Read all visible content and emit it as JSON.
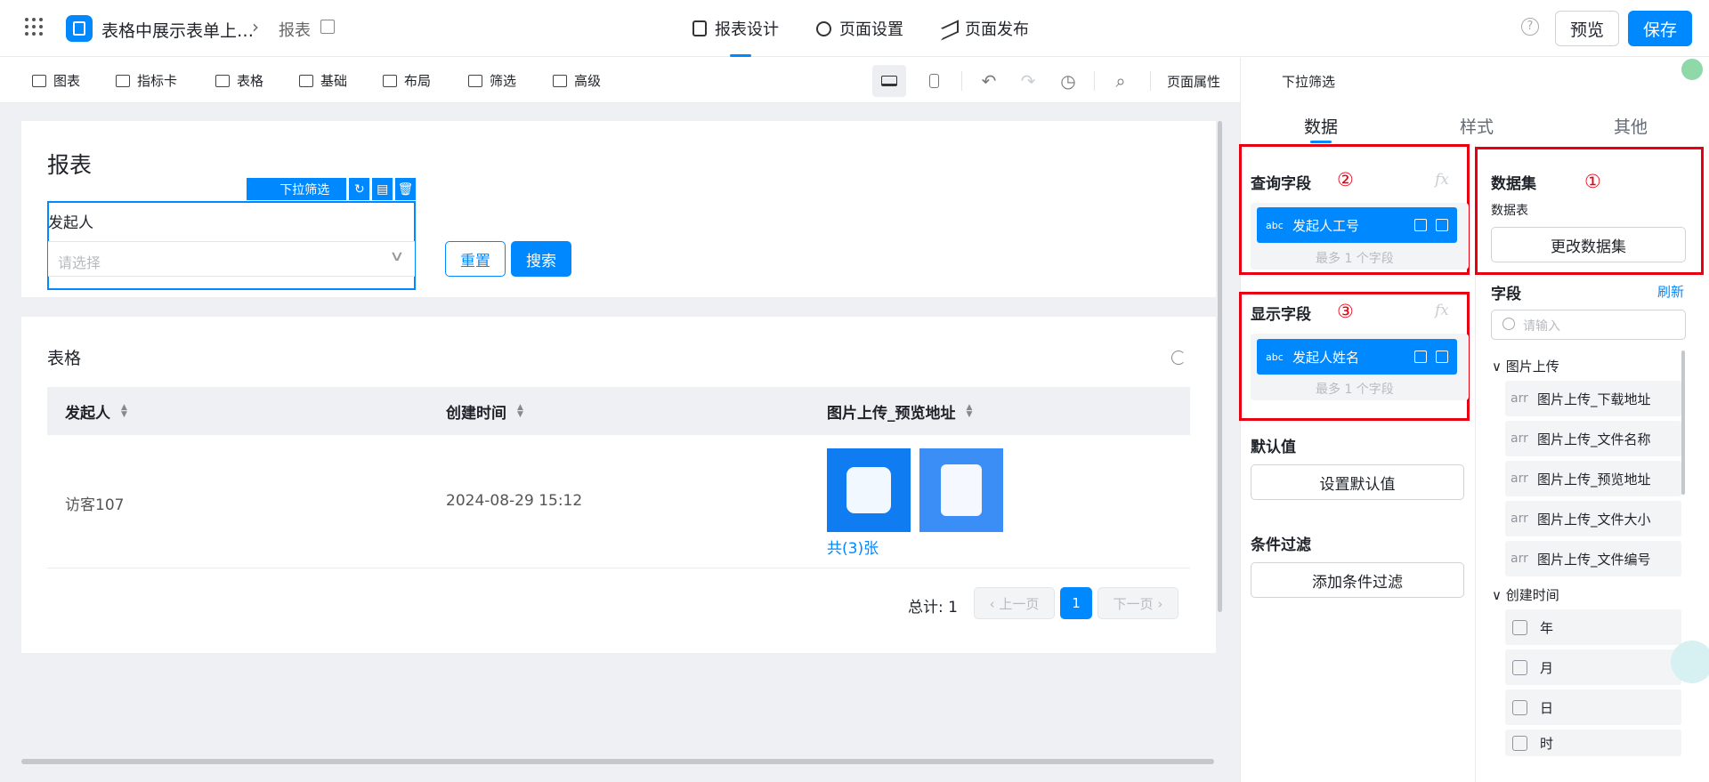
{
  "topbar": {
    "app_title": "表格中展示表单上…",
    "breadcrumb_sep": "›",
    "page_name": "报表",
    "tabs": [
      {
        "label": "报表设计",
        "icon": "report-icon",
        "active": true
      },
      {
        "label": "页面设置",
        "icon": "gear-icon",
        "active": false
      },
      {
        "label": "页面发布",
        "icon": "send-icon",
        "active": false
      }
    ],
    "help": "?",
    "preview_label": "预览",
    "save_label": "保存",
    "accent_color": "#0089ff"
  },
  "toolbar": {
    "items": [
      {
        "label": "图表",
        "icon": "bar-chart-icon"
      },
      {
        "label": "指标卡",
        "icon": "metric-icon"
      },
      {
        "label": "表格",
        "icon": "table-icon"
      },
      {
        "label": "基础",
        "icon": "grid-icon"
      },
      {
        "label": "布局",
        "icon": "layout-icon"
      },
      {
        "label": "筛选",
        "icon": "filter-icon"
      },
      {
        "label": "高级",
        "icon": "layers-icon"
      }
    ],
    "undo": "↶",
    "redo": "↷",
    "history": "◷",
    "search": "⌕",
    "page_props": "页面属性"
  },
  "canvas": {
    "report_title": "报表",
    "component_label": "下拉筛选",
    "component_actions": [
      "↻",
      "▤",
      "🗑"
    ],
    "filter": {
      "label": "发起人",
      "placeholder": "请选择",
      "chevron": "∨",
      "reset_label": "重置",
      "search_label": "搜索"
    },
    "table": {
      "title": "表格",
      "columns": [
        "发起人",
        "创建时间",
        "图片上传_预览地址"
      ],
      "rows": [
        {
          "initiator": "访客107",
          "created": "2024-08-29 15:12",
          "images_link": "共(3)张"
        }
      ],
      "total": "总计: 1",
      "prev": "‹ 上一页",
      "page": "1",
      "next": "下一页 ›"
    }
  },
  "panel": {
    "title": "下拉筛选",
    "tabs": [
      "数据",
      "样式",
      "其他"
    ],
    "query_field": {
      "title": "查询字段",
      "marker": "②",
      "chip_type": "abc",
      "chip_name": "发起人工号",
      "hint": "最多 1 个字段",
      "fx": "fx"
    },
    "display_field": {
      "title": "显示字段",
      "marker": "③",
      "chip_type": "abc",
      "chip_name": "发起人姓名",
      "hint": "最多 1 个字段",
      "fx": "fx"
    },
    "default_value": {
      "title": "默认值",
      "button": "设置默认值"
    },
    "condition": {
      "title": "条件过滤",
      "button": "添加条件过滤"
    },
    "dataset": {
      "title": "数据集",
      "marker": "①",
      "subtitle": "数据表",
      "button": "更改数据集"
    },
    "fields": {
      "title": "字段",
      "refresh": "刷新",
      "search_placeholder": "请输入",
      "groups": [
        {
          "name": "图片上传",
          "items": [
            {
              "type": "arr",
              "label": "图片上传_下载地址"
            },
            {
              "type": "arr",
              "label": "图片上传_文件名称"
            },
            {
              "type": "arr",
              "label": "图片上传_预览地址"
            },
            {
              "type": "arr",
              "label": "图片上传_文件大小"
            },
            {
              "type": "arr",
              "label": "图片上传_文件编号"
            }
          ]
        },
        {
          "name": "创建时间",
          "items": [
            {
              "type": "date",
              "label": "年"
            },
            {
              "type": "date",
              "label": "月"
            },
            {
              "type": "date",
              "label": "日"
            },
            {
              "type": "date",
              "label": "时"
            }
          ]
        }
      ]
    }
  }
}
